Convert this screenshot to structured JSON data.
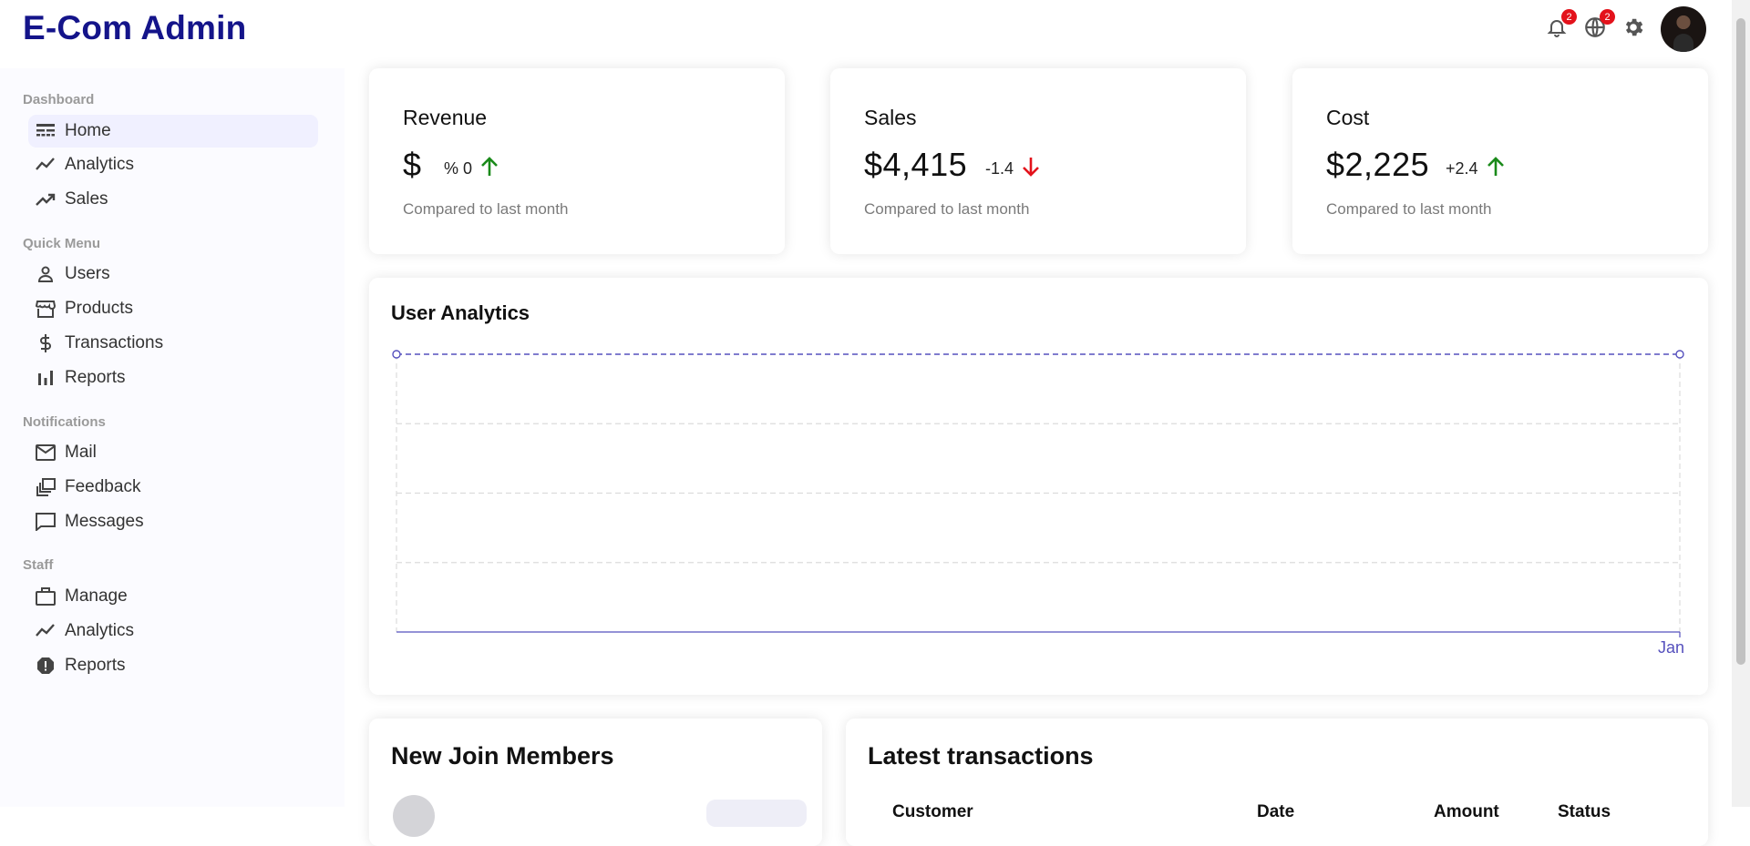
{
  "app": {
    "title": "E-Com Admin"
  },
  "topbar": {
    "notifications": {
      "icon": "bell-icon",
      "badge": "2"
    },
    "language": {
      "icon": "globe-icon",
      "badge": "2"
    },
    "settings": {
      "icon": "gear-icon"
    },
    "avatar": {
      "icon": "user-avatar"
    }
  },
  "sidebar": {
    "sections": [
      {
        "title": "Dashboard",
        "items": [
          {
            "label": "Home",
            "icon": "line-style-icon",
            "active": true
          },
          {
            "label": "Analytics",
            "icon": "timeline-icon"
          },
          {
            "label": "Sales",
            "icon": "trending-up-icon"
          }
        ]
      },
      {
        "title": "Quick Menu",
        "items": [
          {
            "label": "Users",
            "icon": "person-outline-icon"
          },
          {
            "label": "Products",
            "icon": "storefront-icon"
          },
          {
            "label": "Transactions",
            "icon": "dollar-icon"
          },
          {
            "label": "Reports",
            "icon": "bar-chart-icon"
          }
        ]
      },
      {
        "title": "Notifications",
        "items": [
          {
            "label": "Mail",
            "icon": "mail-outline-icon"
          },
          {
            "label": "Feedback",
            "icon": "dynamic-feed-icon"
          },
          {
            "label": "Messages",
            "icon": "chat-bubble-icon"
          }
        ]
      },
      {
        "title": "Staff",
        "items": [
          {
            "label": "Manage",
            "icon": "work-outline-icon"
          },
          {
            "label": "Analytics",
            "icon": "timeline-icon"
          },
          {
            "label": "Reports",
            "icon": "report-icon"
          }
        ]
      }
    ]
  },
  "featured": [
    {
      "title": "Revenue",
      "money": "$",
      "rate": "% 0",
      "trend": "up",
      "sub": "Compared to last month"
    },
    {
      "title": "Sales",
      "money": "$4,415",
      "rate": "-1.4",
      "trend": "down",
      "sub": "Compared to last month"
    },
    {
      "title": "Cost",
      "money": "$2,225",
      "rate": "+2.4",
      "trend": "up",
      "sub": "Compared to last month"
    }
  ],
  "colors": {
    "brand": "#14148a",
    "accent": "#5550bd",
    "up": "#1a8a1a",
    "down": "#e3121b",
    "badge": "#e3121b"
  },
  "user_analytics": {
    "title": "User Analytics",
    "chart_data": {
      "type": "line",
      "title": "User Analytics",
      "categories": [
        "Jan"
      ],
      "grid": true,
      "series": [
        {
          "values": [
            0
          ]
        }
      ]
    }
  },
  "new_members": {
    "title": "New Join Members"
  },
  "transactions": {
    "title": "Latest transactions",
    "columns": [
      "Customer",
      "Date",
      "Amount",
      "Status"
    ]
  }
}
